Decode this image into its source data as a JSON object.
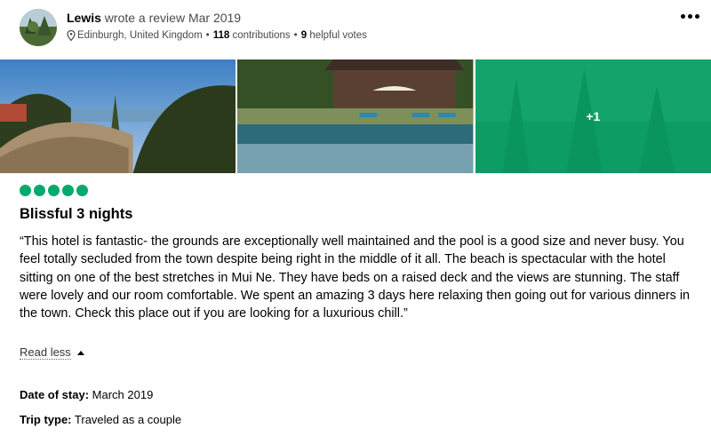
{
  "review": {
    "author": "Lewis",
    "action": "wrote a review",
    "date": "Mar 2019",
    "location": "Edinburgh, United Kingdom",
    "contributions_count": "118",
    "contributions_label": "contributions",
    "helpful_count": "9",
    "helpful_label": "helpful votes",
    "more_photos_label": "+1",
    "rating": 5,
    "title": "Blissful 3 nights",
    "text": "“This hotel is fantastic- the grounds are exceptionally well maintained and the pool is a good size and never busy. You feel totally secluded from the town despite being right in the middle of it all. The beach is spectacular with the hotel sitting on one of the best stretches in Mui Ne. They have beds on a raised deck and the views are stunning. The staff were lovely and our room comfortable. We spent an amazing 3 days here relaxing then going out for various dinners in the town. Check this place out if you are looking for a luxurious chill.”",
    "read_less_label": "Read less",
    "date_of_stay_label": "Date of stay:",
    "date_of_stay": "March 2019",
    "trip_type_label": "Trip type:",
    "trip_type": "Traveled as a couple"
  },
  "colors": {
    "bubble_green": "#00aa6c",
    "overlay_green": "#00aa6c"
  },
  "icons": {
    "location": "map-pin-icon",
    "menu": "more-horizontal-icon",
    "read_less": "caret-up-icon"
  }
}
